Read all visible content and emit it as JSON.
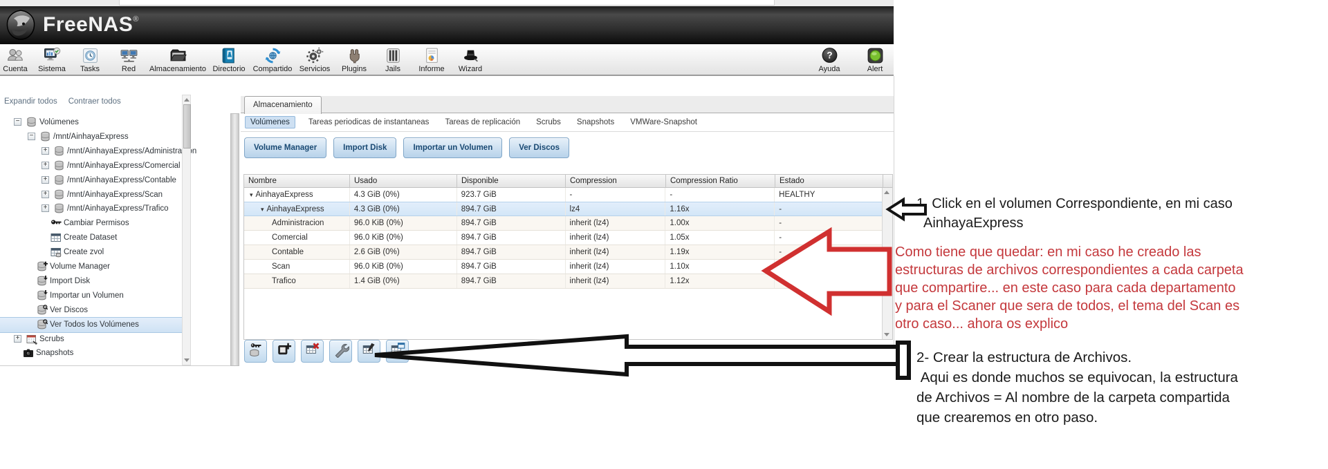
{
  "header": {
    "brand": "FreeNAS",
    "registered": "®"
  },
  "toolbar": {
    "items": [
      {
        "icon": "accounts-icon",
        "label": "Cuenta"
      },
      {
        "icon": "system-icon",
        "label": "Sistema"
      },
      {
        "icon": "tasks-icon",
        "label": "Tasks"
      },
      {
        "icon": "network-icon",
        "label": "Red"
      },
      {
        "icon": "storage-icon",
        "label": "Almacenamiento"
      },
      {
        "icon": "directory-icon",
        "label": "Directorio"
      },
      {
        "icon": "sharing-icon",
        "label": "Compartido"
      },
      {
        "icon": "services-icon",
        "label": "Servicios"
      },
      {
        "icon": "plugins-icon",
        "label": "Plugins"
      },
      {
        "icon": "jails-icon",
        "label": "Jails"
      },
      {
        "icon": "reporting-icon",
        "label": "Informe"
      },
      {
        "icon": "wizard-icon",
        "label": "Wizard"
      }
    ],
    "right": [
      {
        "icon": "help-icon",
        "label": "Ayuda"
      },
      {
        "icon": "alert-icon",
        "label": "Alert"
      }
    ]
  },
  "sidebar": {
    "expand_all": "Expandir todos",
    "collapse_all": "Contraer todos",
    "tree": [
      {
        "label": "Volúmenes",
        "depth": 1,
        "expander": "minus",
        "icon": "volume-icon"
      },
      {
        "label": "/mnt/AinhayaExpress",
        "depth": 2,
        "expander": "minus",
        "icon": "volume-icon"
      },
      {
        "label": "/mnt/AinhayaExpress/Administracion",
        "depth": 3,
        "expander": "plus",
        "icon": "volume-icon"
      },
      {
        "label": "/mnt/AinhayaExpress/Comercial",
        "depth": 3,
        "expander": "plus",
        "icon": "volume-icon"
      },
      {
        "label": "/mnt/AinhayaExpress/Contable",
        "depth": 3,
        "expander": "plus",
        "icon": "volume-icon"
      },
      {
        "label": "/mnt/AinhayaExpress/Scan",
        "depth": 3,
        "expander": "plus",
        "icon": "volume-icon"
      },
      {
        "label": "/mnt/AinhayaExpress/Trafico",
        "depth": 3,
        "expander": "plus",
        "icon": "volume-icon"
      },
      {
        "label": "Cambiar Permisos",
        "depth": 3,
        "expander": null,
        "icon": "key-icon"
      },
      {
        "label": "Create Dataset",
        "depth": 3,
        "expander": null,
        "icon": "dataset-icon"
      },
      {
        "label": "Create zvol",
        "depth": 3,
        "expander": null,
        "icon": "zvol-icon"
      },
      {
        "label": "Volume Manager",
        "depth": 2,
        "expander": null,
        "icon": "volume-add-icon"
      },
      {
        "label": "Import Disk",
        "depth": 2,
        "expander": null,
        "icon": "volume-import-icon"
      },
      {
        "label": "Importar un Volumen",
        "depth": 2,
        "expander": null,
        "icon": "volume-import-icon"
      },
      {
        "label": "Ver Discos",
        "depth": 2,
        "expander": null,
        "icon": "volume-view-icon"
      },
      {
        "label": "Ver Todos los Volúmenes",
        "depth": 2,
        "expander": null,
        "icon": "volume-view-icon",
        "selected": true
      },
      {
        "label": "Scrubs",
        "depth": 1,
        "expander": "plus",
        "icon": "scrub-icon"
      },
      {
        "label": "Snapshots",
        "depth": 1,
        "expander": null,
        "icon": "snapshot-icon"
      }
    ]
  },
  "main": {
    "tab": "Almacenamiento",
    "subtabs": [
      {
        "label": "Volúmenes",
        "selected": true
      },
      {
        "label": "Tareas periodicas de instantaneas",
        "selected": false
      },
      {
        "label": "Tareas de replicación",
        "selected": false
      },
      {
        "label": "Scrubs",
        "selected": false
      },
      {
        "label": "Snapshots",
        "selected": false
      },
      {
        "label": "VMWare-Snapshot",
        "selected": false
      }
    ],
    "buttons": [
      "Volume Manager",
      "Import Disk",
      "Importar un Volumen",
      "Ver Discos"
    ],
    "table": {
      "columns": [
        "Nombre",
        "Usado",
        "Disponible",
        "Compression",
        "Compression Ratio",
        "Estado"
      ],
      "rows": [
        {
          "name": "AinhayaExpress",
          "indent": 0,
          "expander": true,
          "usado": "4.3 GiB (0%)",
          "disponible": "923.7 GiB",
          "compression": "-",
          "ratio": "-",
          "estado": "HEALTHY",
          "selected": false
        },
        {
          "name": "AinhayaExpress",
          "indent": 1,
          "expander": true,
          "usado": "4.3 GiB (0%)",
          "disponible": "894.7 GiB",
          "compression": "lz4",
          "ratio": "1.16x",
          "estado": "-",
          "selected": true
        },
        {
          "name": "Administracion",
          "indent": 2,
          "expander": false,
          "usado": "96.0 KiB (0%)",
          "disponible": "894.7 GiB",
          "compression": "inherit (lz4)",
          "ratio": "1.00x",
          "estado": "-",
          "selected": false
        },
        {
          "name": "Comercial",
          "indent": 2,
          "expander": false,
          "usado": "96.0 KiB (0%)",
          "disponible": "894.7 GiB",
          "compression": "inherit (lz4)",
          "ratio": "1.05x",
          "estado": "-",
          "selected": false
        },
        {
          "name": "Contable",
          "indent": 2,
          "expander": false,
          "usado": "2.6 GiB (0%)",
          "disponible": "894.7 GiB",
          "compression": "inherit (lz4)",
          "ratio": "1.19x",
          "estado": "-",
          "selected": false
        },
        {
          "name": "Scan",
          "indent": 2,
          "expander": false,
          "usado": "96.0 KiB (0%)",
          "disponible": "894.7 GiB",
          "compression": "inherit (lz4)",
          "ratio": "1.10x",
          "estado": "-",
          "selected": false
        },
        {
          "name": "Trafico",
          "indent": 2,
          "expander": false,
          "usado": "1.4 GiB (0%)",
          "disponible": "894.7 GiB",
          "compression": "inherit (lz4)",
          "ratio": "1.12x",
          "estado": "-",
          "selected": false
        }
      ]
    },
    "footer_buttons": [
      {
        "icon": "permissions-icon"
      },
      {
        "icon": "create-dataset-icon"
      },
      {
        "icon": "destroy-dataset-icon"
      },
      {
        "icon": "edit-options-icon"
      },
      {
        "icon": "create-zvol-icon"
      },
      {
        "icon": "manual-snapshot-icon"
      }
    ]
  },
  "annotations": {
    "note1": {
      "lines": [
        "1. Click en el volumen Correspondiente, en mi caso",
        "AinhayaExpress"
      ]
    },
    "note_red": {
      "lines": [
        "Como tiene que quedar: en mi caso he creado las",
        "estructuras de archivos correspondientes a cada carpeta",
        "que compartire... en este caso para cada departamento",
        "y para el Scaner que sera de todos, el tema del Scan es",
        "otro caso... ahora os explico"
      ]
    },
    "note2": {
      "lines": [
        "2- Crear la estructura de Archivos.",
        " Aqui es donde muchos se equivocan, la estructura",
        "de Archivos = Al nombre de la carpeta compartida",
        "que crearemos en otro paso."
      ]
    }
  },
  "colors": {
    "annotation_red": "#c4383c",
    "arrow_red": "#d03030",
    "arrow_black": "#141414",
    "selection_blue": "#d3e6f7",
    "button_blue": "#b7d2ea"
  }
}
